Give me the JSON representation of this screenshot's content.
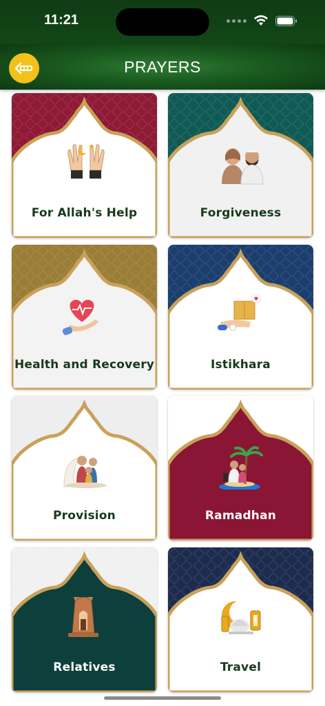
{
  "status_bar": {
    "time": "11:21"
  },
  "header": {
    "title": "PRAYERS"
  },
  "cards": [
    {
      "label": "For Allah's Help",
      "icon": "raised-hands-icon",
      "bg": "#8e1a35",
      "inner": "#ffffff",
      "label_color": "dark"
    },
    {
      "label": "Forgiveness",
      "icon": "two-people-praying-icon",
      "bg": "#0f5a55",
      "inner": "#f1f1f1",
      "label_color": "dark"
    },
    {
      "label": "Health and Recovery",
      "icon": "heart-in-hand-icon",
      "bg": "#9a7d36",
      "inner": "#f3f3f3",
      "label_color": "dark"
    },
    {
      "label": "Istikhara",
      "icon": "delivery-box-icon",
      "bg": "#1b3e6e",
      "inner": "#ffffff",
      "label_color": "dark"
    },
    {
      "label": "Provision",
      "icon": "family-provision-icon",
      "bg": "#eeeeee",
      "inner": "#ffffff",
      "label_color": "dark"
    },
    {
      "label": "Ramadhan",
      "icon": "family-palm-tree-icon",
      "bg": "#ffffff",
      "inner": "#8a1534",
      "label_color": "light"
    },
    {
      "label": "Relatives",
      "icon": "lantern-icon",
      "bg": "#f1f1f1",
      "inner": "#0d3f3d",
      "label_color": "light"
    },
    {
      "label": "Travel",
      "icon": "crescent-lantern-icon",
      "bg": "#1d2c4e",
      "inner": "#ffffff",
      "label_color": "dark"
    }
  ],
  "colors": {
    "gold": "#c9a15a",
    "header_green": "#1a5a1f",
    "back_button": "#f2c21a"
  }
}
